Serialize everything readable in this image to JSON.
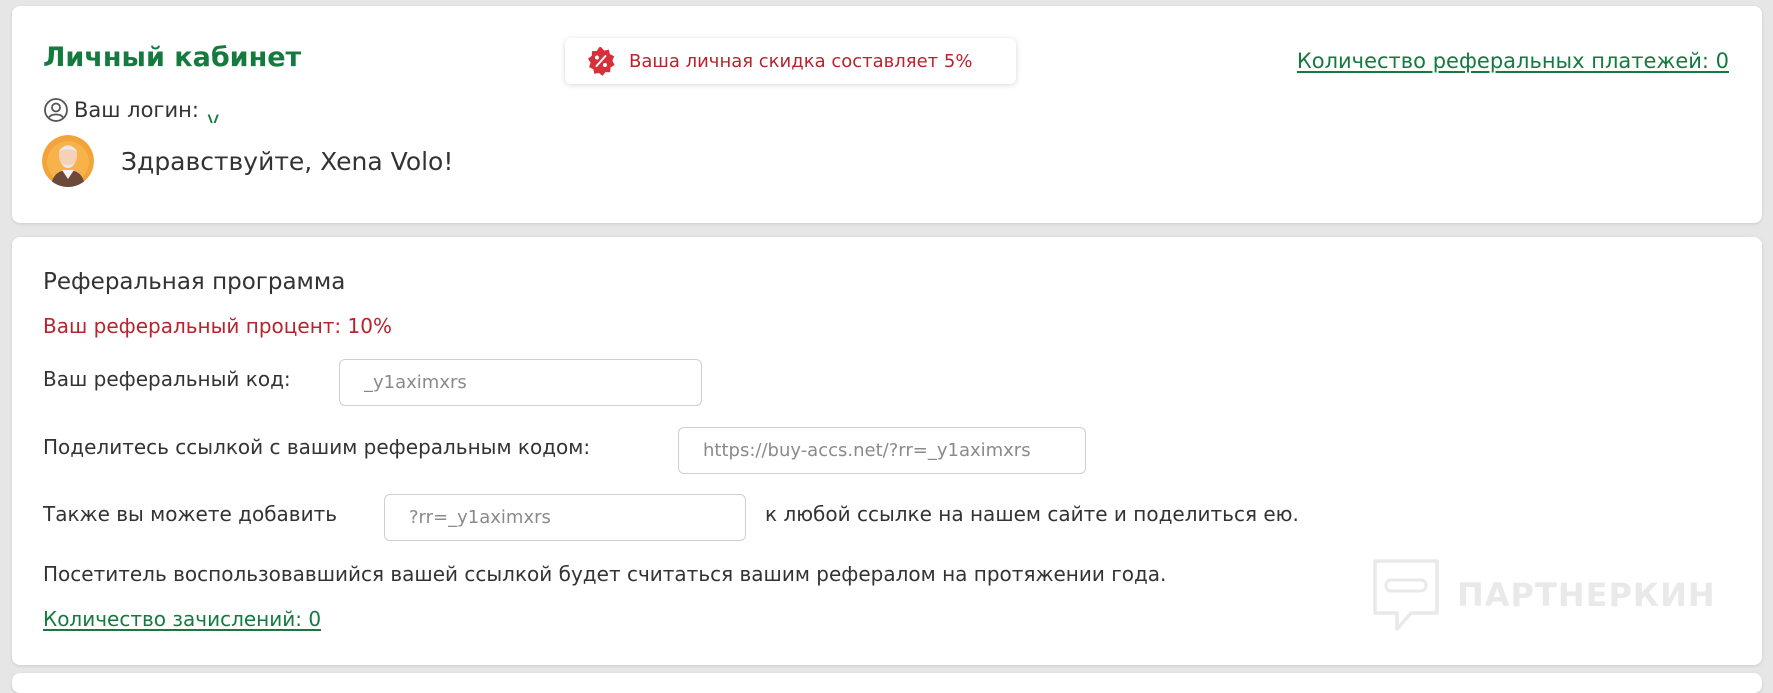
{
  "header": {
    "title": "Личный кабинет",
    "discount_text": "Ваша личная скидка составляет 5%",
    "referral_payments_link": "Количество реферальных платежей: 0",
    "login_label": "Ваш логин:",
    "login_value": "v",
    "greeting": "Здравствуйте, Xena Volo!"
  },
  "referral": {
    "title": "Реферальная программа",
    "percent_text": "Ваш реферальный процент: 10%",
    "code_label": "Ваш реферальный код:",
    "code_value": "_y1aximxrs",
    "link_label": "Поделитесь ссылкой с вашим реферальным кодом:",
    "link_value": "https://buy-accs.net/?rr=_y1aximxrs",
    "param_label_before": "Также вы можете добавить",
    "param_value": "?rr=_y1aximxrs",
    "param_label_after": "к любой ссылке на нашем сайте и поделиться ею.",
    "visitor_note": "Посетитель воспользовавшийся вашей ссылкой будет считаться вашим рефералом на протяжении года.",
    "credits_link": "Количество зачислений: 0"
  },
  "watermark": {
    "text": "ПАРТНЕРКИН"
  },
  "icons": {
    "discount": "percent-badge-icon",
    "login": "user-circle-icon",
    "avatar": "avatar",
    "watermark": "chat-bubble-icon"
  },
  "colors": {
    "accent_green": "#157a3e",
    "alert_red": "#b8232c",
    "discount_badge": "#d6303b",
    "background": "#e6e6e6"
  }
}
